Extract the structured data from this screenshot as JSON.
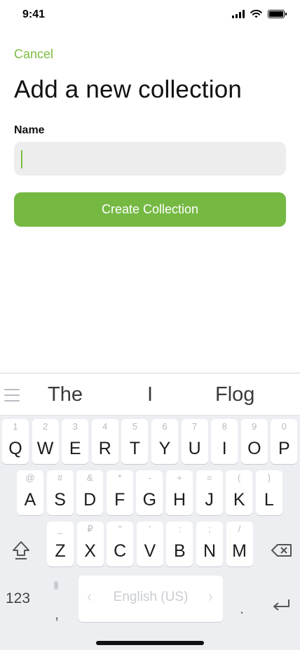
{
  "status": {
    "time": "9:41",
    "battery_level": 1.0
  },
  "header": {
    "cancel_label": "Cancel",
    "title": "Add a new collection"
  },
  "form": {
    "name_label": "Name",
    "name_value": "",
    "create_button_label": "Create Collection"
  },
  "colors": {
    "accent": "#75b943",
    "input_bg": "#ededed",
    "keyboard_bg": "#eceef2"
  },
  "keyboard": {
    "suggestions": [
      "The",
      "I",
      "Flog"
    ],
    "row1": [
      {
        "main": "Q",
        "hint": "1"
      },
      {
        "main": "W",
        "hint": "2"
      },
      {
        "main": "E",
        "hint": "3"
      },
      {
        "main": "R",
        "hint": "4"
      },
      {
        "main": "T",
        "hint": "5"
      },
      {
        "main": "Y",
        "hint": "6"
      },
      {
        "main": "U",
        "hint": "7"
      },
      {
        "main": "I",
        "hint": "8"
      },
      {
        "main": "O",
        "hint": "9"
      },
      {
        "main": "P",
        "hint": "0"
      }
    ],
    "row2": [
      {
        "main": "A",
        "hint": "@"
      },
      {
        "main": "S",
        "hint": "#"
      },
      {
        "main": "D",
        "hint": "&"
      },
      {
        "main": "F",
        "hint": "*"
      },
      {
        "main": "G",
        "hint": "-"
      },
      {
        "main": "H",
        "hint": "+"
      },
      {
        "main": "J",
        "hint": "="
      },
      {
        "main": "K",
        "hint": "("
      },
      {
        "main": "L",
        "hint": ")"
      }
    ],
    "row3": [
      {
        "main": "Z",
        "hint": "_"
      },
      {
        "main": "X",
        "hint": "₽"
      },
      {
        "main": "C",
        "hint": "\""
      },
      {
        "main": "V",
        "hint": "'"
      },
      {
        "main": "B",
        "hint": ":"
      },
      {
        "main": "N",
        "hint": ";"
      },
      {
        "main": "M",
        "hint": "/"
      }
    ],
    "numbers_label": "123",
    "space_label": "English (US)",
    "comma": ",",
    "period": "."
  }
}
